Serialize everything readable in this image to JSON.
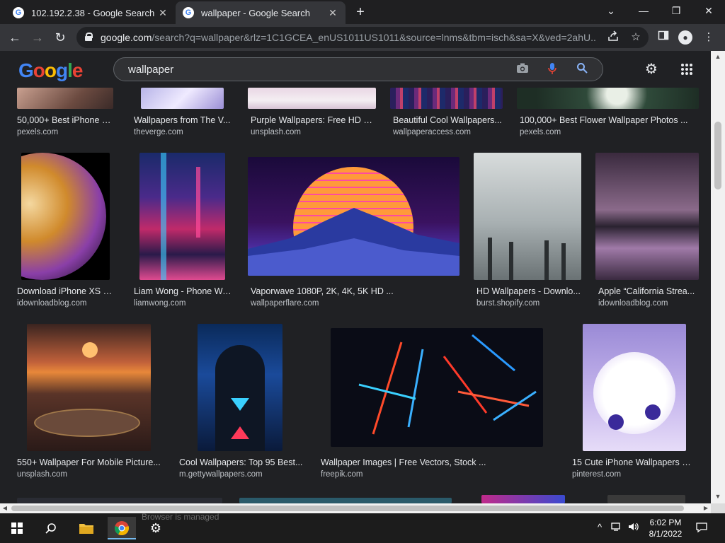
{
  "browser": {
    "tabs": [
      {
        "title": "102.192.2.38 - Google Search",
        "favicon": "G",
        "close": "✕"
      },
      {
        "title": "wallpaper - Google Search",
        "favicon": "G",
        "close": "✕"
      }
    ],
    "new_tab": "+",
    "window_controls": {
      "tab_search": "⌄",
      "minimize": "—",
      "restore": "❐",
      "close": "✕"
    },
    "url_host": "google.com",
    "url_path": "/search?q=wallpaper&rlz=1C1GCEA_enUS1011US1011&source=lnms&tbm=isch&sa=X&ved=2ahU...",
    "nav": {
      "back": "←",
      "forward": "→",
      "reload": "↻"
    }
  },
  "google": {
    "logo": [
      "G",
      "o",
      "o",
      "g",
      "l",
      "e"
    ],
    "logo_colors": [
      "#4285f4",
      "#ea4335",
      "#fbbc05",
      "#4285f4",
      "#34a853",
      "#ea4335"
    ],
    "query": "wallpaper"
  },
  "colors": {
    "background": "#202124",
    "text": "#e8eaed",
    "source": "#bdc1c6",
    "mic_blue": "#4285f4",
    "search_blue": "#8ab4f8"
  },
  "results": [
    {
      "caption": "50,000+ Best iPhone W...",
      "source": "pexels.com"
    },
    {
      "caption": "Wallpapers from The V...",
      "source": "theverge.com"
    },
    {
      "caption": "Purple Wallpapers: Free HD D...",
      "source": "unsplash.com"
    },
    {
      "caption": "Beautiful Cool Wallpapers...",
      "source": "wallpaperaccess.com"
    },
    {
      "caption": "100,000+ Best Flower Wallpaper Photos ...",
      "source": "pexels.com"
    },
    {
      "caption": "Download iPhone XS m...",
      "source": "idownloadblog.com"
    },
    {
      "caption": "Liam Wong - Phone Wa...",
      "source": "liamwong.com"
    },
    {
      "caption": "Vaporwave 1080P, 2K, 4K, 5K HD ...",
      "source": "wallpaperflare.com"
    },
    {
      "caption": "HD Wallpapers - Downlo...",
      "source": "burst.shopify.com"
    },
    {
      "caption": "Apple “California Strea...",
      "source": "idownloadblog.com"
    },
    {
      "caption": "550+ Wallpaper For Mobile Picture...",
      "source": "unsplash.com"
    },
    {
      "caption": "Cool Wallpapers: Top 95 Best...",
      "source": "m.gettywallpapers.com"
    },
    {
      "caption": "Wallpaper Images | Free Vectors, Stock ...",
      "source": "freepik.com"
    },
    {
      "caption": "15 Cute iPhone Wallpapers H...",
      "source": "pinterest.com"
    }
  ],
  "taskbar": {
    "managed_notice": "Browser is managed",
    "time": "6:02 PM",
    "date": "8/1/2022"
  }
}
